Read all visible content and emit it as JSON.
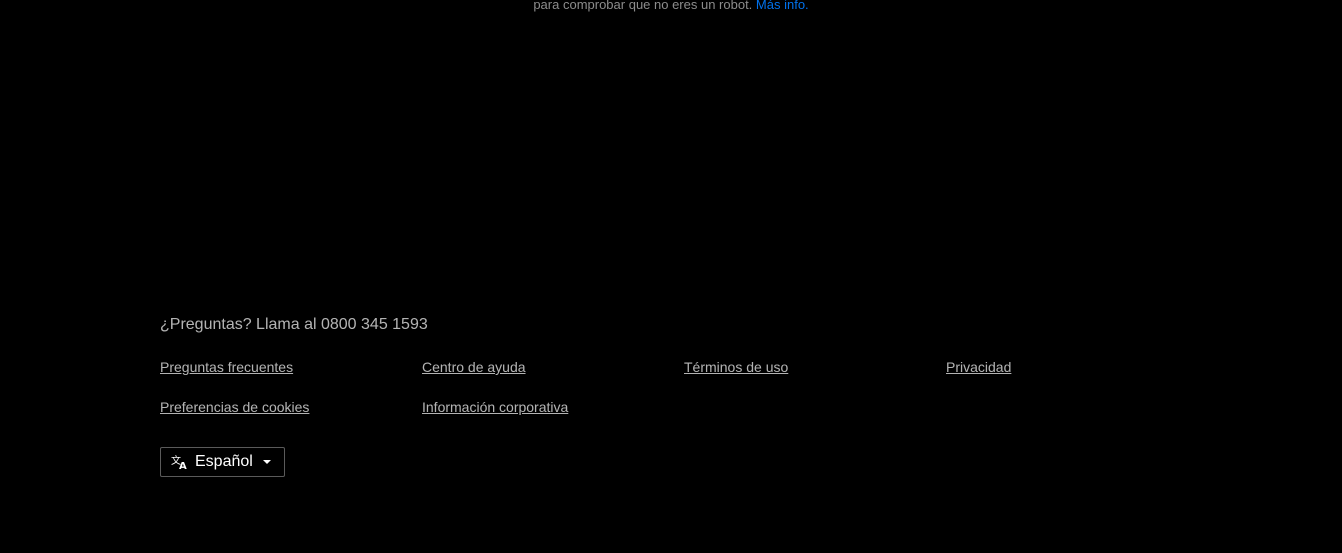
{
  "recaptcha": {
    "text": "para comprobar que no eres un robot.",
    "link": "Más info."
  },
  "footer": {
    "questions": "¿Preguntas? Llama al 0800 345 1593",
    "links": [
      {
        "label": "Preguntas frecuentes"
      },
      {
        "label": "Centro de ayuda"
      },
      {
        "label": "Términos de uso"
      },
      {
        "label": "Privacidad"
      },
      {
        "label": "Preferencias de cookies"
      },
      {
        "label": "Información corporativa"
      }
    ],
    "language": {
      "selected": "Español",
      "icon": "translate-icon"
    }
  },
  "colors": {
    "background": "#000000",
    "link_accent": "#0071eb"
  }
}
